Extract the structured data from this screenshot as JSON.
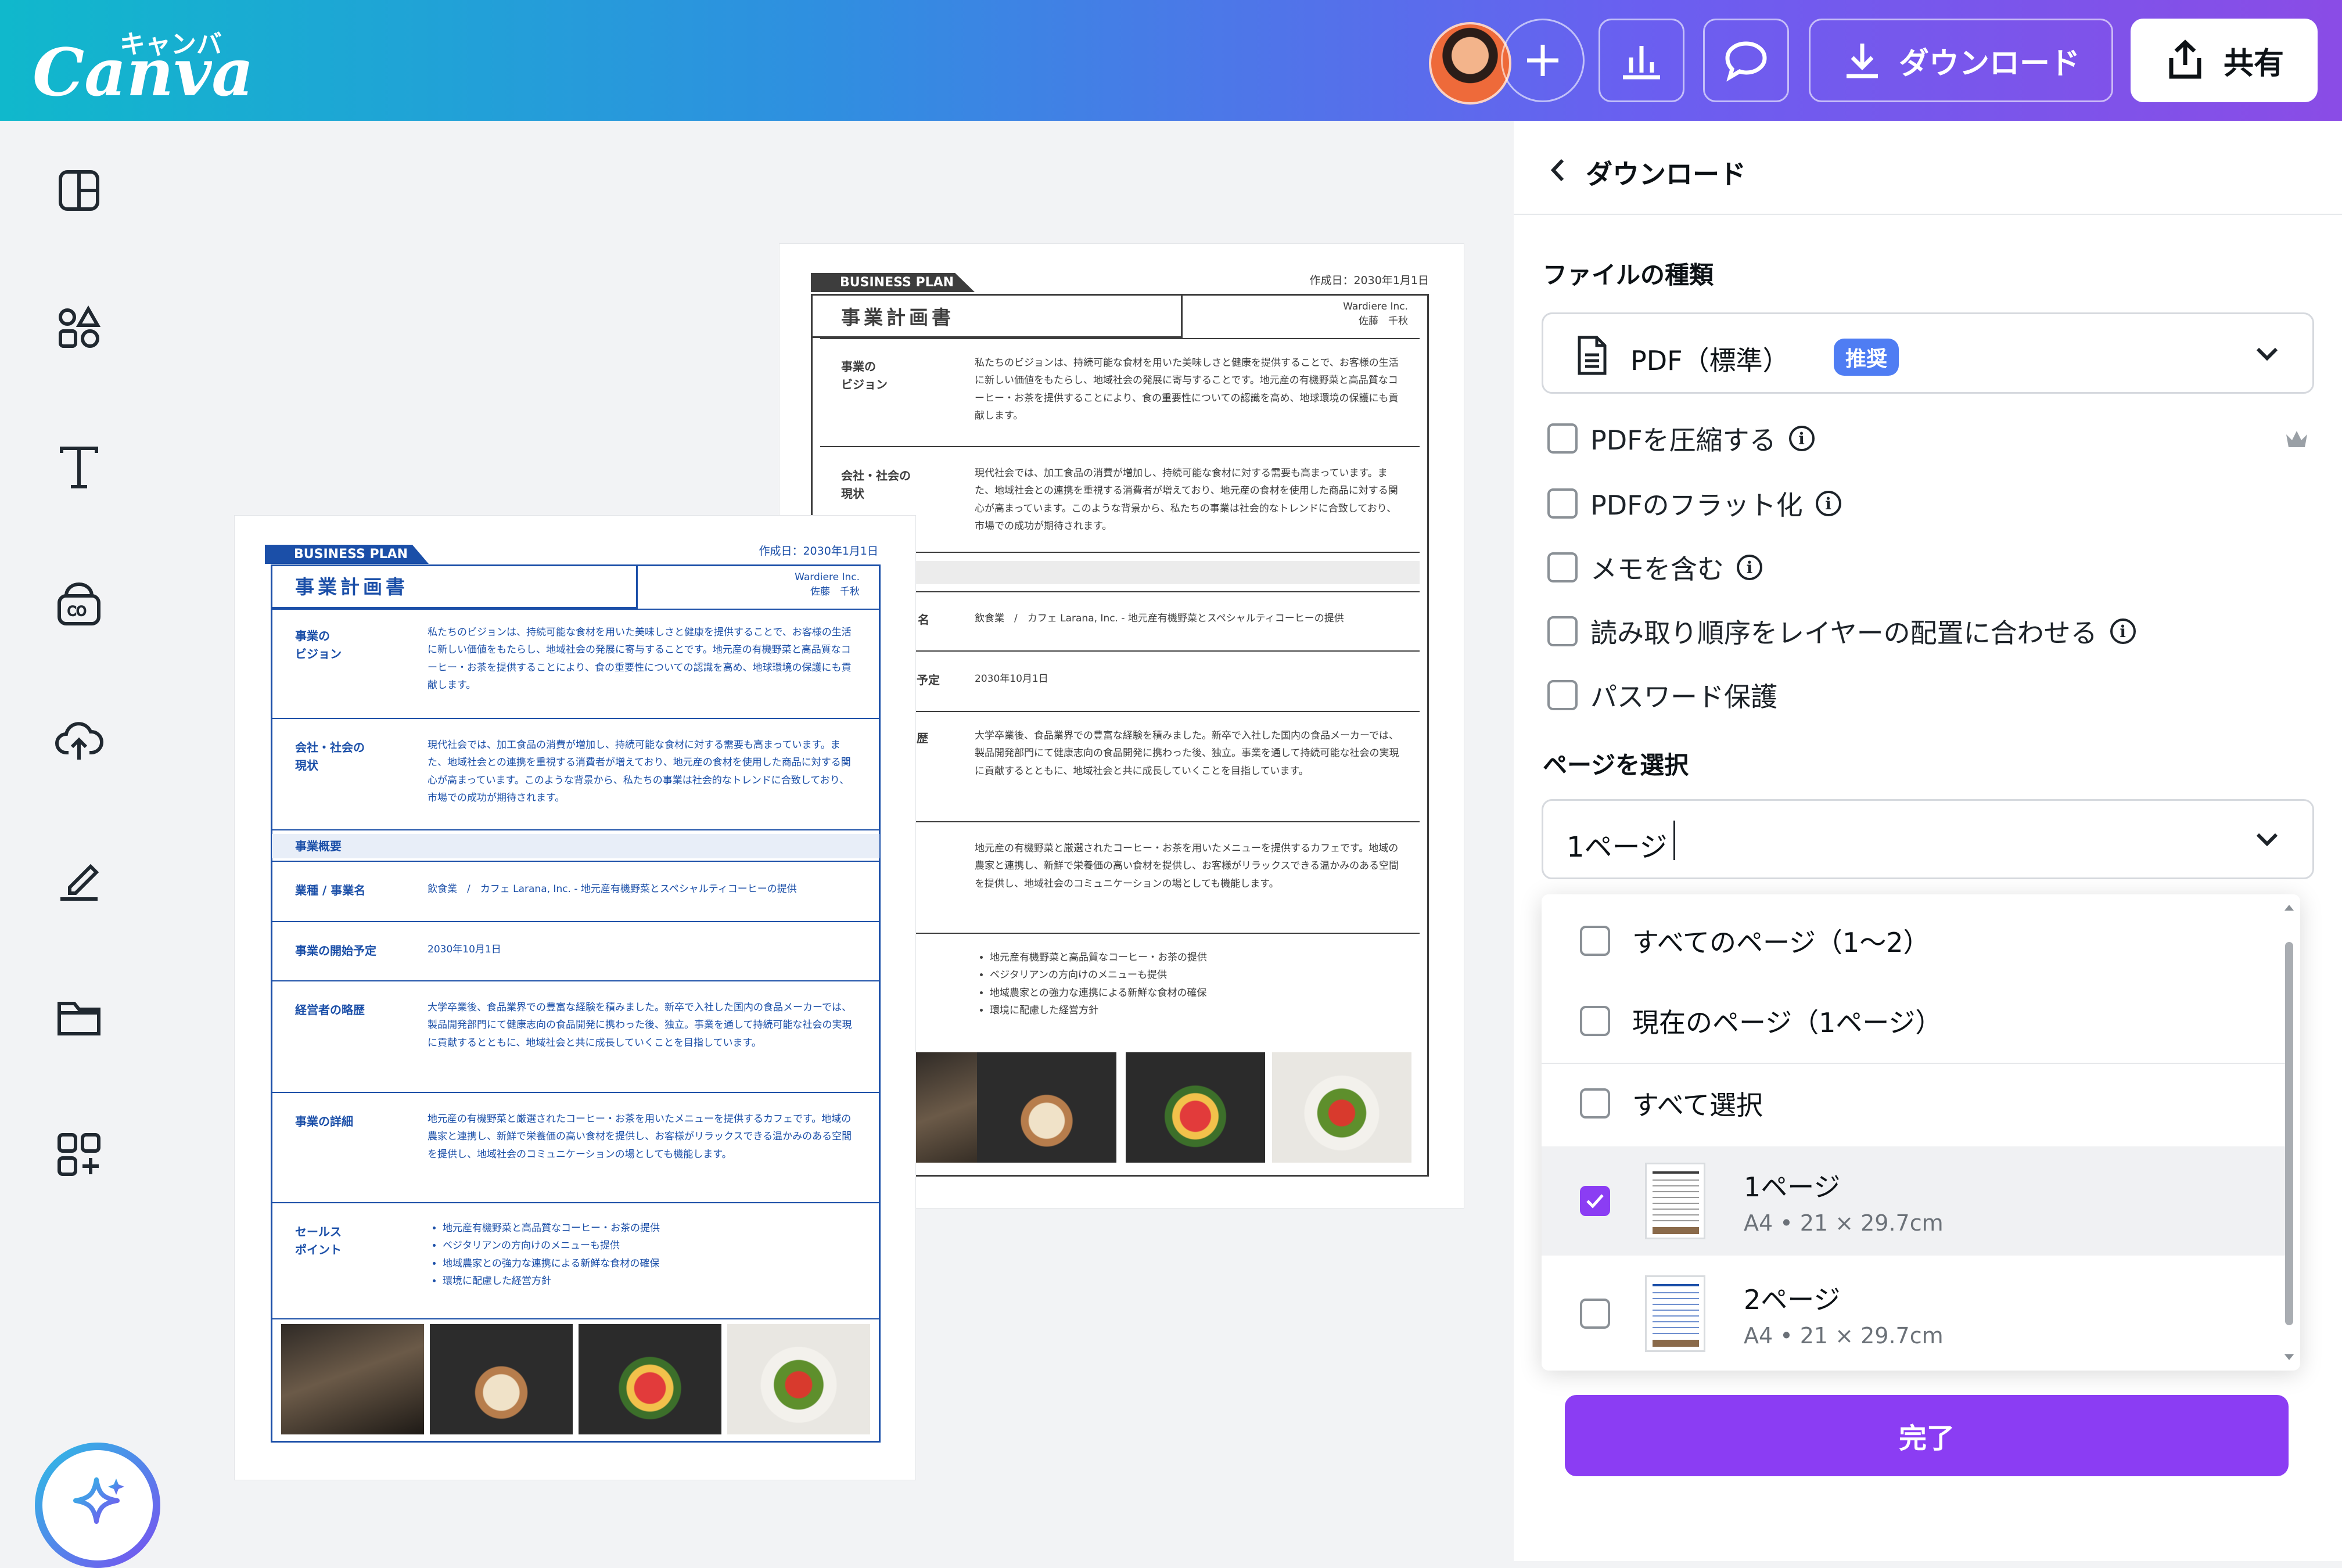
{
  "app": {
    "logo_text": "Canva",
    "logo_kana": "キャンバ"
  },
  "colors": {
    "accent": "#8b3df3",
    "badge": "#4f7df3",
    "doc_front": "#1b4fa8",
    "doc_back": "#3d3d3d"
  },
  "toolbar": {
    "add_icon": "plus-icon",
    "insights_icon": "bar-chart-icon",
    "comment_icon": "comment-icon",
    "download_label": "ダウンロード",
    "share_label": "共有"
  },
  "sidebar": {
    "items": [
      {
        "icon": "design-layout-icon"
      },
      {
        "icon": "elements-icon"
      },
      {
        "icon": "text-icon"
      },
      {
        "icon": "brand-icon"
      },
      {
        "icon": "cloud-upload-icon"
      },
      {
        "icon": "draw-icon"
      },
      {
        "icon": "folder-icon"
      },
      {
        "icon": "apps-icon"
      }
    ],
    "magic_icon": "sparkle-icon"
  },
  "document": {
    "tag": "BUSINESS PLAN",
    "date": "作成日：2030年1月1日",
    "title": "事業計画書",
    "company": "Wardiere Inc.",
    "person": "佐藤　千秋",
    "sections": {
      "vision": {
        "label": "事業の\nビジョン",
        "text": "私たちのビジョンは、持続可能な食材を用いた美味しさと健康を提供することで、お客様の生活に新しい価値をもたらし、地域社会の発展に寄与することです。地元産の有機野菜と高品質なコーヒー・お茶を提供することにより、食の重要性についての認識を高め、地球環境の保護にも貢献します。"
      },
      "social": {
        "label": "会社・社会の\n現状",
        "text": "現代社会では、加工食品の消費が増加し、持続可能な食材に対する需要も高まっています。また、地域社会との連携を重視する消費者が増えており、地元産の食材を使用した商品に対する関心が高まっています。このような背景から、私たちの事業は社会的なトレンドに合致しており、市場での成功が期待されます。"
      },
      "overview": {
        "label": "事業概要"
      },
      "business": {
        "label": "業種 / 事業名",
        "text": "飲食業　/　カフェ Larana, Inc. - 地元産有機野菜とスペシャルティコーヒーの提供"
      },
      "start": {
        "label": "事業の開始予定",
        "text": "2030年10月1日"
      },
      "history": {
        "label": "経営者の略歴",
        "text": "大学卒業後、食品業界での豊富な経験を積みました。新卒で入社した国内の食品メーカーでは、製品開発部門にて健康志向の食品開発に携わった後、独立。事業を通して持続可能な社会の実現に貢献するとともに、地域社会と共に成長していくことを目指しています。"
      },
      "details": {
        "label": "事業の詳細",
        "text": "地元産の有機野菜と厳選されたコーヒー・お茶を用いたメニューを提供するカフェです。地域の農家と連携し、新鮮で栄養価の高い食材を提供し、お客様がリラックスできる温かみのある空間を提供し、地域社会のコミュニケーションの場としても機能します。"
      },
      "sales": {
        "label": "セールス\nポイント",
        "items": [
          "地元産有機野菜と高品質なコーヒー・お茶の提供",
          "ベジタリアンの方向けのメニューも提供",
          "地域農家との強力な連携による新鮮な食材の確保",
          "環境に配慮した経営方針"
        ]
      }
    },
    "back_cut": {
      "business": "名",
      "start": "予定",
      "history": "歴"
    }
  },
  "panel": {
    "title": "ダウンロード",
    "file_type_label": "ファイルの種類",
    "file_type_value": "PDF（標準）",
    "file_type_badge": "推奨",
    "options": [
      {
        "label": "PDFを圧縮する",
        "checked": false,
        "info": true,
        "premium": true
      },
      {
        "label": "PDFのフラット化",
        "checked": false,
        "info": true
      },
      {
        "label": "メモを含む",
        "checked": false,
        "info": true
      },
      {
        "label": "読み取り順序をレイヤーの配置に合わせる",
        "checked": false,
        "info": true
      },
      {
        "label": "パスワード保護",
        "checked": false,
        "info": false
      }
    ],
    "page_select_label": "ページを選択",
    "page_select_value": "1ページ",
    "dropdown": {
      "all_pages": "すべてのページ（1〜2）",
      "current_page": "現在のページ（1ページ）",
      "select_all": "すべて選択",
      "pages": [
        {
          "name": "1ページ",
          "size": "A4 • 21 × 29.7cm",
          "checked": true
        },
        {
          "name": "2ページ",
          "size": "A4 • 21 × 29.7cm",
          "checked": false
        }
      ]
    },
    "done_label": "完了"
  }
}
